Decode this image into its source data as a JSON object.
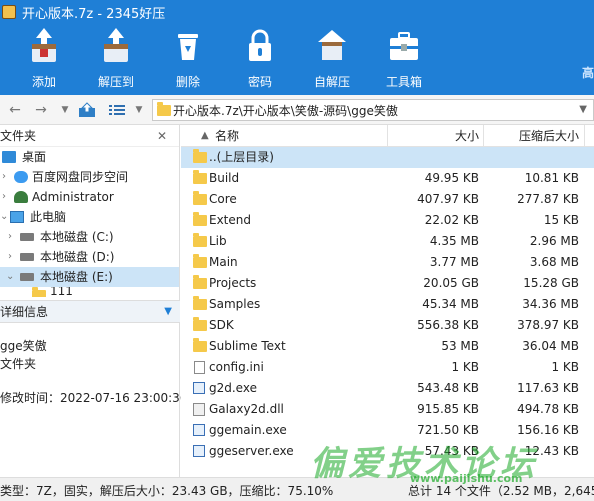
{
  "window": {
    "title": "开心版本.7z - 2345好压"
  },
  "toolbar": {
    "items": [
      {
        "label": "添加",
        "icon": "add-archive-icon"
      },
      {
        "label": "解压到",
        "icon": "extract-icon"
      },
      {
        "label": "删除",
        "icon": "delete-icon"
      },
      {
        "label": "密码",
        "icon": "lock-icon"
      },
      {
        "label": "自解压",
        "icon": "self-extract-icon"
      },
      {
        "label": "工具箱",
        "icon": "toolbox-icon"
      }
    ],
    "brand": "高"
  },
  "address": {
    "path": "开心版本.7z\\开心版本\\笑傲-源码\\gge笑傲"
  },
  "sidebar": {
    "header": "文件夹",
    "tree": [
      {
        "label": "桌面",
        "icon": "desktop-icon"
      },
      {
        "label": "百度网盘同步空间",
        "icon": "cloud-icon"
      },
      {
        "label": "Administrator",
        "icon": "user-icon"
      },
      {
        "label": "此电脑",
        "icon": "computer-icon"
      },
      {
        "label": "本地磁盘 (C:)",
        "icon": "disk-icon"
      },
      {
        "label": "本地磁盘 (D:)",
        "icon": "disk-icon"
      },
      {
        "label": "本地磁盘 (E:)",
        "icon": "disk-icon"
      },
      {
        "label": "111",
        "icon": "folder-icon"
      }
    ]
  },
  "details": {
    "header": "详细信息",
    "name": "gge笑傲",
    "type": "文件夹",
    "modified": "修改时间：2022-07-16 23:00:36"
  },
  "list": {
    "columns": {
      "name": "名称",
      "size": "大小",
      "compressed": "压缩后大小"
    },
    "rows": [
      {
        "name": "..(上层目录)",
        "size": "",
        "compressed": "",
        "type": "folder"
      },
      {
        "name": "Build",
        "size": "49.95 KB",
        "compressed": "10.81 KB",
        "type": "folder"
      },
      {
        "name": "Core",
        "size": "407.97 KB",
        "compressed": "277.87 KB",
        "type": "folder"
      },
      {
        "name": "Extend",
        "size": "22.02 KB",
        "compressed": "15 KB",
        "type": "folder"
      },
      {
        "name": "Lib",
        "size": "4.35 MB",
        "compressed": "2.96 MB",
        "type": "folder"
      },
      {
        "name": "Main",
        "size": "3.77 MB",
        "compressed": "3.68 MB",
        "type": "folder"
      },
      {
        "name": "Projects",
        "size": "20.05 GB",
        "compressed": "15.28 GB",
        "type": "folder"
      },
      {
        "name": "Samples",
        "size": "45.34 MB",
        "compressed": "34.36 MB",
        "type": "folder"
      },
      {
        "name": "SDK",
        "size": "556.38 KB",
        "compressed": "378.97 KB",
        "type": "folder"
      },
      {
        "name": "Sublime Text",
        "size": "53 MB",
        "compressed": "36.04 MB",
        "type": "folder"
      },
      {
        "name": "config.ini",
        "size": "1 KB",
        "compressed": "1 KB",
        "type": "file"
      },
      {
        "name": "g2d.exe",
        "size": "543.48 KB",
        "compressed": "117.63 KB",
        "type": "exe"
      },
      {
        "name": "Galaxy2d.dll",
        "size": "915.85 KB",
        "compressed": "494.78 KB",
        "type": "dll"
      },
      {
        "name": "ggemain.exe",
        "size": "721.50 KB",
        "compressed": "156.16 KB",
        "type": "exe"
      },
      {
        "name": "ggeserver.exe",
        "size": "57.43 KB",
        "compressed": "12.43 KB",
        "type": "exe"
      }
    ]
  },
  "status": {
    "left": "类型：7Z，固实，解压后大小：23.43 GB，压缩比：75.10%",
    "right": "总计 14 个文件（2.52 MB，2,645,"
  },
  "watermark": {
    "big": "偏爱技术论坛",
    "small": "www.paijishu.com"
  }
}
